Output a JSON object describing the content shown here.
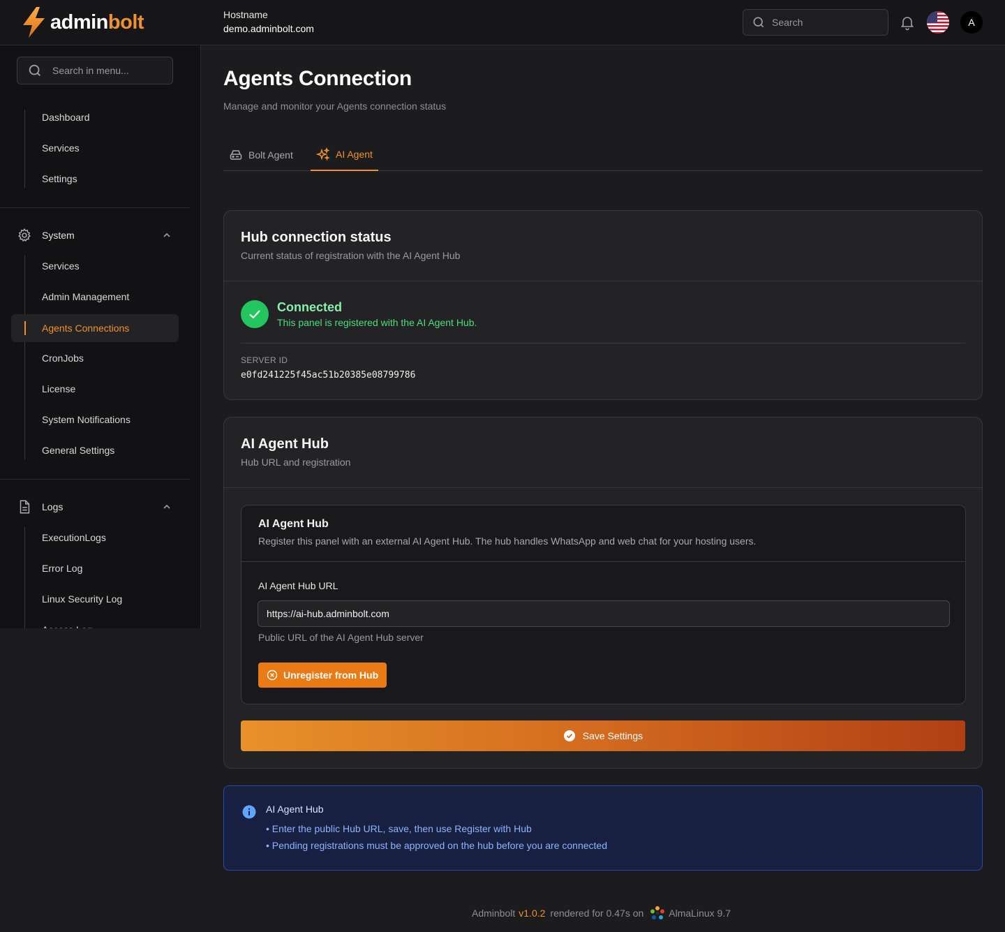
{
  "brand": {
    "part1": "admin",
    "part2": "bolt"
  },
  "header": {
    "hostname_label": "Hostname",
    "hostname_value": "demo.adminbolt.com",
    "search_placeholder": "Search",
    "avatar_letter": "A"
  },
  "sidebar": {
    "search_placeholder": "Search in menu...",
    "top_items": [
      {
        "label": "Dashboard"
      },
      {
        "label": "Services"
      },
      {
        "label": "Settings"
      }
    ],
    "groups": [
      {
        "label": "System",
        "icon": "gear-icon",
        "items": [
          {
            "label": "Services"
          },
          {
            "label": "Admin Management"
          },
          {
            "label": "Agents Connections",
            "active": true
          },
          {
            "label": "CronJobs"
          },
          {
            "label": "License"
          },
          {
            "label": "System Notifications"
          },
          {
            "label": "General Settings"
          }
        ]
      },
      {
        "label": "Logs",
        "icon": "document-icon",
        "items": [
          {
            "label": "ExecutionLogs"
          },
          {
            "label": "Error Log"
          },
          {
            "label": "Linux Security Log"
          },
          {
            "label": "Access Log"
          }
        ]
      }
    ]
  },
  "page": {
    "title": "Agents Connection",
    "subtitle": "Manage and monitor your Agents connection status",
    "tabs": [
      {
        "label": "Bolt Agent",
        "icon": "server-icon",
        "active": false
      },
      {
        "label": "AI Agent",
        "icon": "sparkles-icon",
        "active": true
      }
    ]
  },
  "hub_status": {
    "title": "Hub connection status",
    "description": "Current status of registration with the AI Agent Hub",
    "status": "Connected",
    "status_message": "This panel is registered with the AI Agent Hub.",
    "server_id_label": "SERVER ID",
    "server_id": "e0fd241225f45ac51b20385e08799786"
  },
  "hub_settings": {
    "title": "AI Agent Hub",
    "description": "Hub URL and registration",
    "inner_title": "AI Agent Hub",
    "inner_description": "Register this panel with an external AI Agent Hub. The hub handles WhatsApp and web chat for your hosting users.",
    "url_label": "AI Agent Hub URL",
    "url_value": "https://ai-hub.adminbolt.com",
    "url_help": "Public URL of the AI Agent Hub server",
    "unregister_label": "Unregister from Hub",
    "save_label": "Save Settings"
  },
  "info": {
    "title": "AI Agent Hub",
    "lines": [
      "• Enter the public Hub URL, save, then use Register with Hub",
      "• Pending registrations must be approved on the hub before you are connected"
    ]
  },
  "footer": {
    "app": "Adminbolt",
    "version": "v1.0.2",
    "rendered": "rendered for 0.47s on",
    "os": "AlmaLinux 9.7"
  },
  "colors": {
    "accent": "#f0922b",
    "success": "#22c55e",
    "info_bg": "#172040"
  }
}
